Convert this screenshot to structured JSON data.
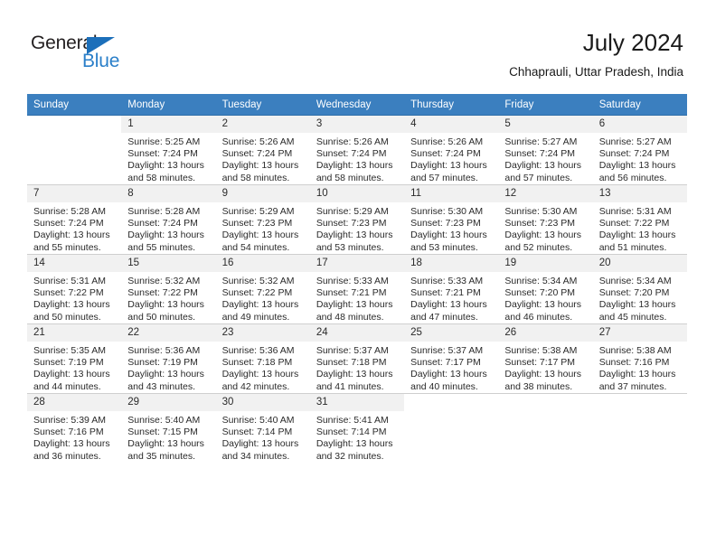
{
  "brand": {
    "name_dark": "General",
    "name_blue": "Blue",
    "accent_color": "#2a7fc9",
    "triangle_color": "#1c6fba"
  },
  "header": {
    "title": "July 2024",
    "subtitle": "Chhaprauli, Uttar Pradesh, India",
    "header_bg_color": "#3b7fbf",
    "daynum_bg_color": "#f1f1f1"
  },
  "weekday_headers": [
    "Sunday",
    "Monday",
    "Tuesday",
    "Wednesday",
    "Thursday",
    "Friday",
    "Saturday"
  ],
  "weeks": [
    [
      {
        "day": "",
        "sunrise": "",
        "sunset": "",
        "daylight_line1": "",
        "daylight_line2": "",
        "blank": true
      },
      {
        "day": "1",
        "sunrise": "Sunrise: 5:25 AM",
        "sunset": "Sunset: 7:24 PM",
        "daylight_line1": "Daylight: 13 hours",
        "daylight_line2": "and 58 minutes."
      },
      {
        "day": "2",
        "sunrise": "Sunrise: 5:26 AM",
        "sunset": "Sunset: 7:24 PM",
        "daylight_line1": "Daylight: 13 hours",
        "daylight_line2": "and 58 minutes."
      },
      {
        "day": "3",
        "sunrise": "Sunrise: 5:26 AM",
        "sunset": "Sunset: 7:24 PM",
        "daylight_line1": "Daylight: 13 hours",
        "daylight_line2": "and 58 minutes."
      },
      {
        "day": "4",
        "sunrise": "Sunrise: 5:26 AM",
        "sunset": "Sunset: 7:24 PM",
        "daylight_line1": "Daylight: 13 hours",
        "daylight_line2": "and 57 minutes."
      },
      {
        "day": "5",
        "sunrise": "Sunrise: 5:27 AM",
        "sunset": "Sunset: 7:24 PM",
        "daylight_line1": "Daylight: 13 hours",
        "daylight_line2": "and 57 minutes."
      },
      {
        "day": "6",
        "sunrise": "Sunrise: 5:27 AM",
        "sunset": "Sunset: 7:24 PM",
        "daylight_line1": "Daylight: 13 hours",
        "daylight_line2": "and 56 minutes."
      }
    ],
    [
      {
        "day": "7",
        "sunrise": "Sunrise: 5:28 AM",
        "sunset": "Sunset: 7:24 PM",
        "daylight_line1": "Daylight: 13 hours",
        "daylight_line2": "and 55 minutes."
      },
      {
        "day": "8",
        "sunrise": "Sunrise: 5:28 AM",
        "sunset": "Sunset: 7:24 PM",
        "daylight_line1": "Daylight: 13 hours",
        "daylight_line2": "and 55 minutes."
      },
      {
        "day": "9",
        "sunrise": "Sunrise: 5:29 AM",
        "sunset": "Sunset: 7:23 PM",
        "daylight_line1": "Daylight: 13 hours",
        "daylight_line2": "and 54 minutes."
      },
      {
        "day": "10",
        "sunrise": "Sunrise: 5:29 AM",
        "sunset": "Sunset: 7:23 PM",
        "daylight_line1": "Daylight: 13 hours",
        "daylight_line2": "and 53 minutes."
      },
      {
        "day": "11",
        "sunrise": "Sunrise: 5:30 AM",
        "sunset": "Sunset: 7:23 PM",
        "daylight_line1": "Daylight: 13 hours",
        "daylight_line2": "and 53 minutes."
      },
      {
        "day": "12",
        "sunrise": "Sunrise: 5:30 AM",
        "sunset": "Sunset: 7:23 PM",
        "daylight_line1": "Daylight: 13 hours",
        "daylight_line2": "and 52 minutes."
      },
      {
        "day": "13",
        "sunrise": "Sunrise: 5:31 AM",
        "sunset": "Sunset: 7:22 PM",
        "daylight_line1": "Daylight: 13 hours",
        "daylight_line2": "and 51 minutes."
      }
    ],
    [
      {
        "day": "14",
        "sunrise": "Sunrise: 5:31 AM",
        "sunset": "Sunset: 7:22 PM",
        "daylight_line1": "Daylight: 13 hours",
        "daylight_line2": "and 50 minutes."
      },
      {
        "day": "15",
        "sunrise": "Sunrise: 5:32 AM",
        "sunset": "Sunset: 7:22 PM",
        "daylight_line1": "Daylight: 13 hours",
        "daylight_line2": "and 50 minutes."
      },
      {
        "day": "16",
        "sunrise": "Sunrise: 5:32 AM",
        "sunset": "Sunset: 7:22 PM",
        "daylight_line1": "Daylight: 13 hours",
        "daylight_line2": "and 49 minutes."
      },
      {
        "day": "17",
        "sunrise": "Sunrise: 5:33 AM",
        "sunset": "Sunset: 7:21 PM",
        "daylight_line1": "Daylight: 13 hours",
        "daylight_line2": "and 48 minutes."
      },
      {
        "day": "18",
        "sunrise": "Sunrise: 5:33 AM",
        "sunset": "Sunset: 7:21 PM",
        "daylight_line1": "Daylight: 13 hours",
        "daylight_line2": "and 47 minutes."
      },
      {
        "day": "19",
        "sunrise": "Sunrise: 5:34 AM",
        "sunset": "Sunset: 7:20 PM",
        "daylight_line1": "Daylight: 13 hours",
        "daylight_line2": "and 46 minutes."
      },
      {
        "day": "20",
        "sunrise": "Sunrise: 5:34 AM",
        "sunset": "Sunset: 7:20 PM",
        "daylight_line1": "Daylight: 13 hours",
        "daylight_line2": "and 45 minutes."
      }
    ],
    [
      {
        "day": "21",
        "sunrise": "Sunrise: 5:35 AM",
        "sunset": "Sunset: 7:19 PM",
        "daylight_line1": "Daylight: 13 hours",
        "daylight_line2": "and 44 minutes."
      },
      {
        "day": "22",
        "sunrise": "Sunrise: 5:36 AM",
        "sunset": "Sunset: 7:19 PM",
        "daylight_line1": "Daylight: 13 hours",
        "daylight_line2": "and 43 minutes."
      },
      {
        "day": "23",
        "sunrise": "Sunrise: 5:36 AM",
        "sunset": "Sunset: 7:18 PM",
        "daylight_line1": "Daylight: 13 hours",
        "daylight_line2": "and 42 minutes."
      },
      {
        "day": "24",
        "sunrise": "Sunrise: 5:37 AM",
        "sunset": "Sunset: 7:18 PM",
        "daylight_line1": "Daylight: 13 hours",
        "daylight_line2": "and 41 minutes."
      },
      {
        "day": "25",
        "sunrise": "Sunrise: 5:37 AM",
        "sunset": "Sunset: 7:17 PM",
        "daylight_line1": "Daylight: 13 hours",
        "daylight_line2": "and 40 minutes."
      },
      {
        "day": "26",
        "sunrise": "Sunrise: 5:38 AM",
        "sunset": "Sunset: 7:17 PM",
        "daylight_line1": "Daylight: 13 hours",
        "daylight_line2": "and 38 minutes."
      },
      {
        "day": "27",
        "sunrise": "Sunrise: 5:38 AM",
        "sunset": "Sunset: 7:16 PM",
        "daylight_line1": "Daylight: 13 hours",
        "daylight_line2": "and 37 minutes."
      }
    ],
    [
      {
        "day": "28",
        "sunrise": "Sunrise: 5:39 AM",
        "sunset": "Sunset: 7:16 PM",
        "daylight_line1": "Daylight: 13 hours",
        "daylight_line2": "and 36 minutes."
      },
      {
        "day": "29",
        "sunrise": "Sunrise: 5:40 AM",
        "sunset": "Sunset: 7:15 PM",
        "daylight_line1": "Daylight: 13 hours",
        "daylight_line2": "and 35 minutes."
      },
      {
        "day": "30",
        "sunrise": "Sunrise: 5:40 AM",
        "sunset": "Sunset: 7:14 PM",
        "daylight_line1": "Daylight: 13 hours",
        "daylight_line2": "and 34 minutes."
      },
      {
        "day": "31",
        "sunrise": "Sunrise: 5:41 AM",
        "sunset": "Sunset: 7:14 PM",
        "daylight_line1": "Daylight: 13 hours",
        "daylight_line2": "and 32 minutes."
      },
      {
        "day": "",
        "sunrise": "",
        "sunset": "",
        "daylight_line1": "",
        "daylight_line2": "",
        "blank": true
      },
      {
        "day": "",
        "sunrise": "",
        "sunset": "",
        "daylight_line1": "",
        "daylight_line2": "",
        "blank": true
      },
      {
        "day": "",
        "sunrise": "",
        "sunset": "",
        "daylight_line1": "",
        "daylight_line2": "",
        "blank": true
      }
    ]
  ]
}
